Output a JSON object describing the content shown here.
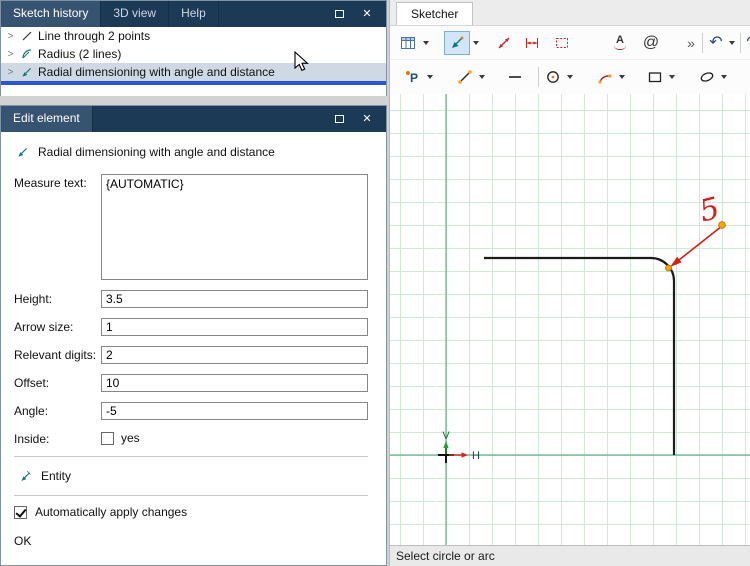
{
  "colors": {
    "titlebar": "#1c3a56",
    "titlebar_active_tab": "#365471",
    "selection_underline": "#2b55d4",
    "grid": "#cfe9d4",
    "axis_green": "#44a07c",
    "dimension_red": "#d81e10",
    "handle_orange": "#f7a600"
  },
  "icons": {
    "close": "✕",
    "expander": ">",
    "overflow": "»",
    "undo": "↶",
    "redo": "↷",
    "at": "@",
    "text_tool": "A",
    "point_tool": "P"
  },
  "sketch_history": {
    "tabs": [
      "Sketch history",
      "3D view",
      "Help"
    ],
    "items": [
      {
        "label": "Line through 2 points",
        "selected": false
      },
      {
        "label": "Radius (2 lines)",
        "selected": false
      },
      {
        "label": "Radial dimensioning with angle and distance",
        "selected": true
      }
    ]
  },
  "edit_element": {
    "tab": "Edit element",
    "header": "Radial dimensioning with angle and distance",
    "measure": {
      "label": "Measure text:",
      "value": "{AUTOMATIC}"
    },
    "fields": [
      {
        "label": "Height:",
        "value": "3.5"
      },
      {
        "label": "Arrow size:",
        "value": "1"
      },
      {
        "label": "Relevant digits:",
        "value": "2"
      },
      {
        "label": "Offset:",
        "value": "10"
      },
      {
        "label": "Angle:",
        "value": "-5"
      }
    ],
    "inside": {
      "label": "Inside:",
      "option": "yes",
      "checked": false
    },
    "entity_label": "Entity",
    "auto_apply": {
      "label": "Automatically apply changes",
      "checked": true
    },
    "ok_label": "OK"
  },
  "sketcher": {
    "tab": "Sketcher",
    "status": "Select circle or arc",
    "radial_tool_active": true,
    "dimension_value": "5",
    "axis_labels": {
      "v": "V",
      "h": "H"
    },
    "toolbar_row1": [
      "data-table",
      "radial-dimension",
      "diagonal-dimension",
      "horizontal-dimension",
      "selection-box",
      "text",
      "at",
      "overflow",
      "undo",
      "redo"
    ],
    "toolbar_row2": [
      "point",
      "line",
      "segment",
      "circle",
      "arc",
      "rectangle",
      "ellipse"
    ]
  }
}
